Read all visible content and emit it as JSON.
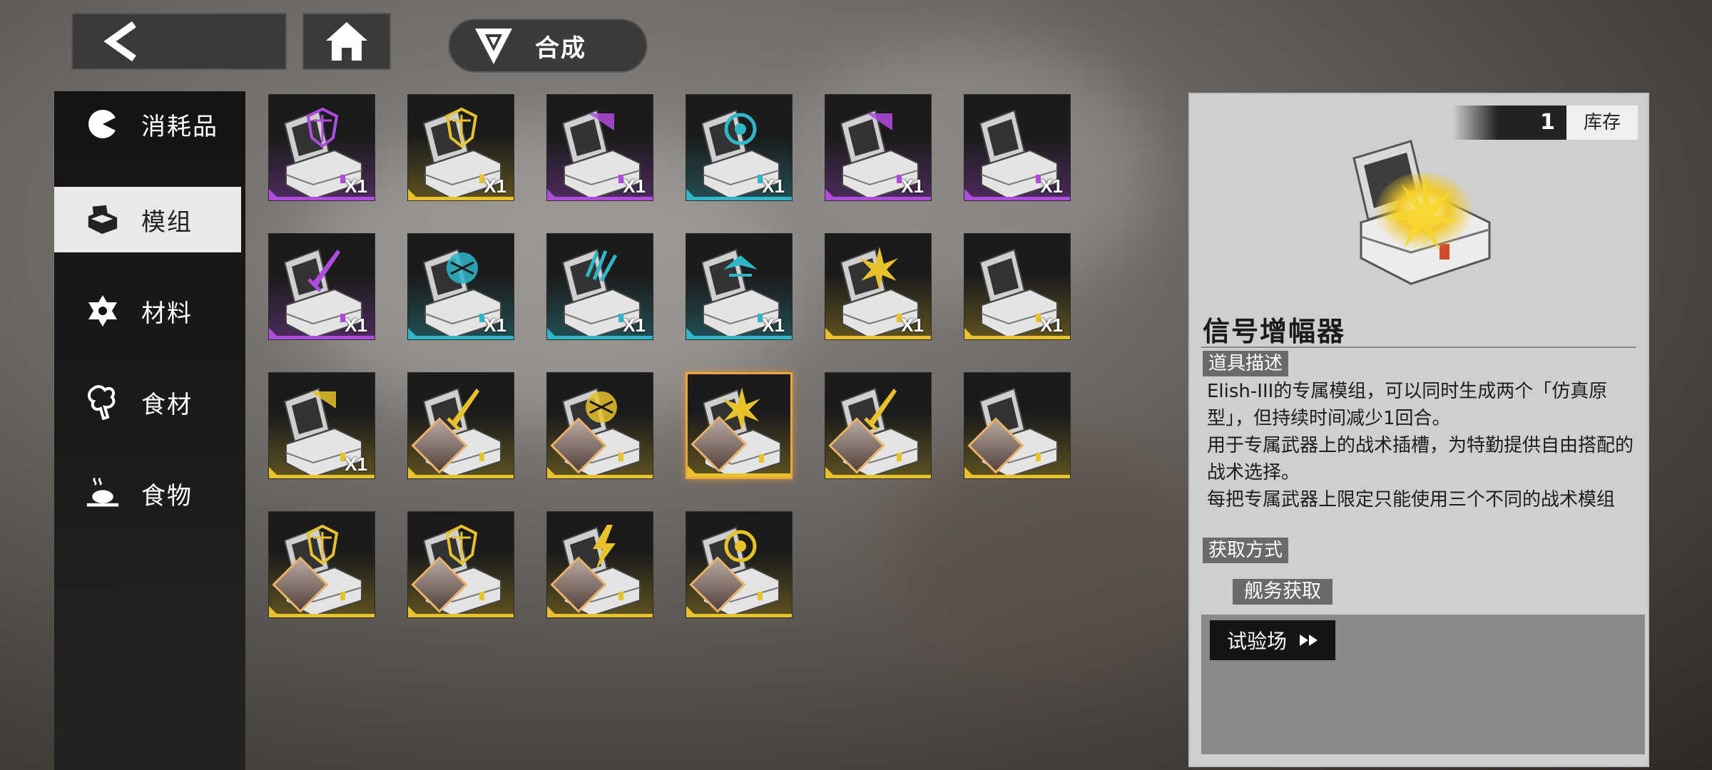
{
  "header": {
    "title": "合成"
  },
  "sidebar": {
    "items": [
      {
        "label": "消耗品",
        "icon": "pie-icon",
        "active": false
      },
      {
        "label": "模组",
        "icon": "box-icon",
        "active": true
      },
      {
        "label": "材料",
        "icon": "star-icon",
        "active": false
      },
      {
        "label": "食材",
        "icon": "herb-icon",
        "active": false
      },
      {
        "label": "食物",
        "icon": "dish-icon",
        "active": false
      }
    ]
  },
  "grid": {
    "items": [
      {
        "rarity": "purple",
        "symbol": "emblem",
        "qty": "X1"
      },
      {
        "rarity": "gold",
        "symbol": "emblem",
        "qty": "X1"
      },
      {
        "rarity": "purple",
        "symbol": "shield",
        "qty": "X1"
      },
      {
        "rarity": "blue",
        "symbol": "ring",
        "qty": "X1"
      },
      {
        "rarity": "purple",
        "symbol": "shield",
        "qty": "X1"
      },
      {
        "rarity": "purple",
        "symbol": "swirl",
        "qty": "X1"
      },
      {
        "rarity": "purple",
        "symbol": "blade",
        "qty": "X1"
      },
      {
        "rarity": "blue",
        "symbol": "orb",
        "qty": "X1"
      },
      {
        "rarity": "blue",
        "symbol": "claw",
        "qty": "X1"
      },
      {
        "rarity": "blue",
        "symbol": "wing",
        "qty": "X1"
      },
      {
        "rarity": "gold",
        "symbol": "burst",
        "qty": "X1"
      },
      {
        "rarity": "gold",
        "symbol": "wave",
        "qty": "X1"
      },
      {
        "rarity": "gold",
        "symbol": "shield",
        "qty": "X1"
      },
      {
        "rarity": "gold",
        "symbol": "blade",
        "qty": "",
        "portrait": true
      },
      {
        "rarity": "gold",
        "symbol": "orb",
        "qty": "",
        "portrait": true
      },
      {
        "rarity": "gold",
        "symbol": "burst",
        "qty": "",
        "portrait": true,
        "selected": true
      },
      {
        "rarity": "gold",
        "symbol": "blade",
        "qty": "",
        "portrait": true
      },
      {
        "rarity": "gold",
        "symbol": "wave",
        "qty": "",
        "portrait": true
      },
      {
        "rarity": "gold",
        "symbol": "emblem",
        "qty": "",
        "portrait": true
      },
      {
        "rarity": "gold",
        "symbol": "emblem",
        "qty": "",
        "portrait": true
      },
      {
        "rarity": "gold",
        "symbol": "bolt",
        "qty": "",
        "portrait": true
      },
      {
        "rarity": "gold",
        "symbol": "ring",
        "qty": "",
        "portrait": true
      }
    ]
  },
  "detail": {
    "stock_count": "1",
    "stock_label": "库存",
    "name": "信号增幅器",
    "desc_tag": "道具描述",
    "description": [
      "Elish-III的专属模组，可以同时生成两个「仿真原型」，但持续时间减少1回合。",
      "用于专属武器上的战术插槽，为特勤提供自由搭配的战术选择。",
      "每把专属武器上限定只能使用三个不同的战术模组"
    ],
    "acquire_tag": "获取方式",
    "source_label": "舰务获取",
    "test_button": "试验场"
  },
  "colors": {
    "gold": "#e8c22a",
    "purple": "#b04be0",
    "blue": "#2fb6c8",
    "selected_border": "#f0a53a"
  }
}
